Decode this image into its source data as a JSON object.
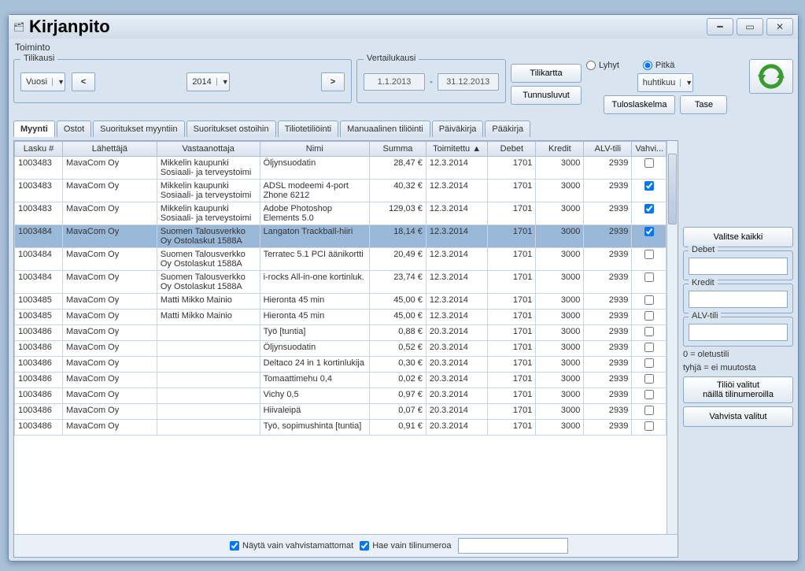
{
  "window": {
    "title": "Kirjanpito"
  },
  "menubar": {
    "item1": "Toiminto"
  },
  "tilikausi": {
    "legend": "Tilikausi",
    "vuosi": "Vuosi",
    "year": "2014",
    "prev": "<",
    "next": ">"
  },
  "vertailukausi": {
    "legend": "Vertailukausi",
    "from": "1.1.2013",
    "to": "31.12.2013",
    "sep": "-"
  },
  "buttons": {
    "tilikartta": "Tilikartta",
    "tunnusluvut": "Tunnusluvut",
    "tuloslaskelma": "Tuloslaskelma",
    "tase": "Tase"
  },
  "view": {
    "lyhyt": "Lyhyt",
    "pitka": "Pitkä",
    "month": "huhtikuu"
  },
  "tabs": [
    "Myynti",
    "Ostot",
    "Suoritukset myyntiin",
    "Suoritukset ostoihin",
    "Tiliotetiliöinti",
    "Manuaalinen tiliöinti",
    "Päiväkirja",
    "Pääkirja"
  ],
  "columns": {
    "lasku": "Lasku #",
    "lahettaja": "Lähettäjä",
    "vastaanottaja": "Vastaanottaja",
    "nimi": "Nimi",
    "summa": "Summa",
    "toimitettu": "Toimitettu ▲",
    "debet": "Debet",
    "kredit": "Kredit",
    "alvtili": "ALV-tili",
    "vahvi": "Vahvi..."
  },
  "rows": [
    {
      "lasku": "1003483",
      "lah": "MavaCom Oy",
      "vas": "Mikkelin kaupunki Sosiaali- ja terveystoimi",
      "nimi": "Öljynsuodatin",
      "sum": "28,47 €",
      "toi": "12.3.2014",
      "deb": "1701",
      "kre": "3000",
      "alv": "2939",
      "vah": false
    },
    {
      "lasku": "1003483",
      "lah": "MavaCom Oy",
      "vas": "Mikkelin kaupunki Sosiaali- ja terveystoimi",
      "nimi": "ADSL modeemi 4-port Zhone 6212",
      "sum": "40,32 €",
      "toi": "12.3.2014",
      "deb": "1701",
      "kre": "3000",
      "alv": "2939",
      "vah": true
    },
    {
      "lasku": "1003483",
      "lah": "MavaCom Oy",
      "vas": "Mikkelin kaupunki Sosiaali- ja terveystoimi",
      "nimi": "Adobe Photoshop Elements 5.0",
      "sum": "129,03 €",
      "toi": "12.3.2014",
      "deb": "1701",
      "kre": "3000",
      "alv": "2939",
      "vah": true
    },
    {
      "lasku": "1003484",
      "lah": "MavaCom Oy",
      "vas": "Suomen Talousverkko Oy Ostolaskut 1588A",
      "nimi": "Langaton Trackball-hiiri",
      "sum": "18,14 €",
      "toi": "12.3.2014",
      "deb": "1701",
      "kre": "3000",
      "alv": "2939",
      "vah": true,
      "selected": true
    },
    {
      "lasku": "1003484",
      "lah": "MavaCom Oy",
      "vas": "Suomen Talousverkko Oy Ostolaskut 1588A",
      "nimi": "Terratec 5.1 PCI äänikortti",
      "sum": "20,49 €",
      "toi": "12.3.2014",
      "deb": "1701",
      "kre": "3000",
      "alv": "2939",
      "vah": false
    },
    {
      "lasku": "1003484",
      "lah": "MavaCom Oy",
      "vas": "Suomen Talousverkko Oy Ostolaskut 1588A",
      "nimi": "i-rocks All-in-one kortinluk.",
      "sum": "23,74 €",
      "toi": "12.3.2014",
      "deb": "1701",
      "kre": "3000",
      "alv": "2939",
      "vah": false
    },
    {
      "lasku": "1003485",
      "lah": "MavaCom Oy",
      "vas": "Matti Mikko Mainio",
      "nimi": "Hieronta 45 min",
      "sum": "45,00 €",
      "toi": "12.3.2014",
      "deb": "1701",
      "kre": "3000",
      "alv": "2939",
      "vah": false
    },
    {
      "lasku": "1003485",
      "lah": "MavaCom Oy",
      "vas": "Matti Mikko Mainio",
      "nimi": "Hieronta 45 min",
      "sum": "45,00 €",
      "toi": "12.3.2014",
      "deb": "1701",
      "kre": "3000",
      "alv": "2939",
      "vah": false
    },
    {
      "lasku": "1003486",
      "lah": "MavaCom Oy",
      "vas": "",
      "nimi": "Työ [tuntia]",
      "sum": "0,88 €",
      "toi": "20.3.2014",
      "deb": "1701",
      "kre": "3000",
      "alv": "2939",
      "vah": false
    },
    {
      "lasku": "1003486",
      "lah": "MavaCom Oy",
      "vas": "",
      "nimi": "Öljynsuodatin",
      "sum": "0,52 €",
      "toi": "20.3.2014",
      "deb": "1701",
      "kre": "3000",
      "alv": "2939",
      "vah": false
    },
    {
      "lasku": "1003486",
      "lah": "MavaCom Oy",
      "vas": "",
      "nimi": "Deltaco 24 in 1 kortinlukija",
      "sum": "0,30 €",
      "toi": "20.3.2014",
      "deb": "1701",
      "kre": "3000",
      "alv": "2939",
      "vah": false
    },
    {
      "lasku": "1003486",
      "lah": "MavaCom Oy",
      "vas": "",
      "nimi": "Tomaattimehu 0,4",
      "sum": "0,02 €",
      "toi": "20.3.2014",
      "deb": "1701",
      "kre": "3000",
      "alv": "2939",
      "vah": false
    },
    {
      "lasku": "1003486",
      "lah": "MavaCom Oy",
      "vas": "",
      "nimi": "Vichy 0,5",
      "sum": "0,97 €",
      "toi": "20.3.2014",
      "deb": "1701",
      "kre": "3000",
      "alv": "2939",
      "vah": false
    },
    {
      "lasku": "1003486",
      "lah": "MavaCom Oy",
      "vas": "",
      "nimi": "Hiivaleipä",
      "sum": "0,07 €",
      "toi": "20.3.2014",
      "deb": "1701",
      "kre": "3000",
      "alv": "2939",
      "vah": false
    },
    {
      "lasku": "1003486",
      "lah": "MavaCom Oy",
      "vas": "",
      "nimi": "Työ, sopimushinta [tuntia]",
      "sum": "0,91 €",
      "toi": "20.3.2014",
      "deb": "1701",
      "kre": "3000",
      "alv": "2939",
      "vah": false
    }
  ],
  "bottom": {
    "nayta": "Näytä vain vahvistamattomat",
    "hae": "Hae vain tilinumeroa"
  },
  "side": {
    "valitse_kaikki": "Valitse kaikki",
    "debet": "Debet",
    "kredit": "Kredit",
    "alvtili": "ALV-tili",
    "hint1": "0 = oletustili",
    "hint2": "tyhjä = ei muutosta",
    "tilioi1": "Tiliöi valitut",
    "tilioi2": "näillä tilinumeroilla",
    "vahvista": "Vahvista valitut"
  }
}
